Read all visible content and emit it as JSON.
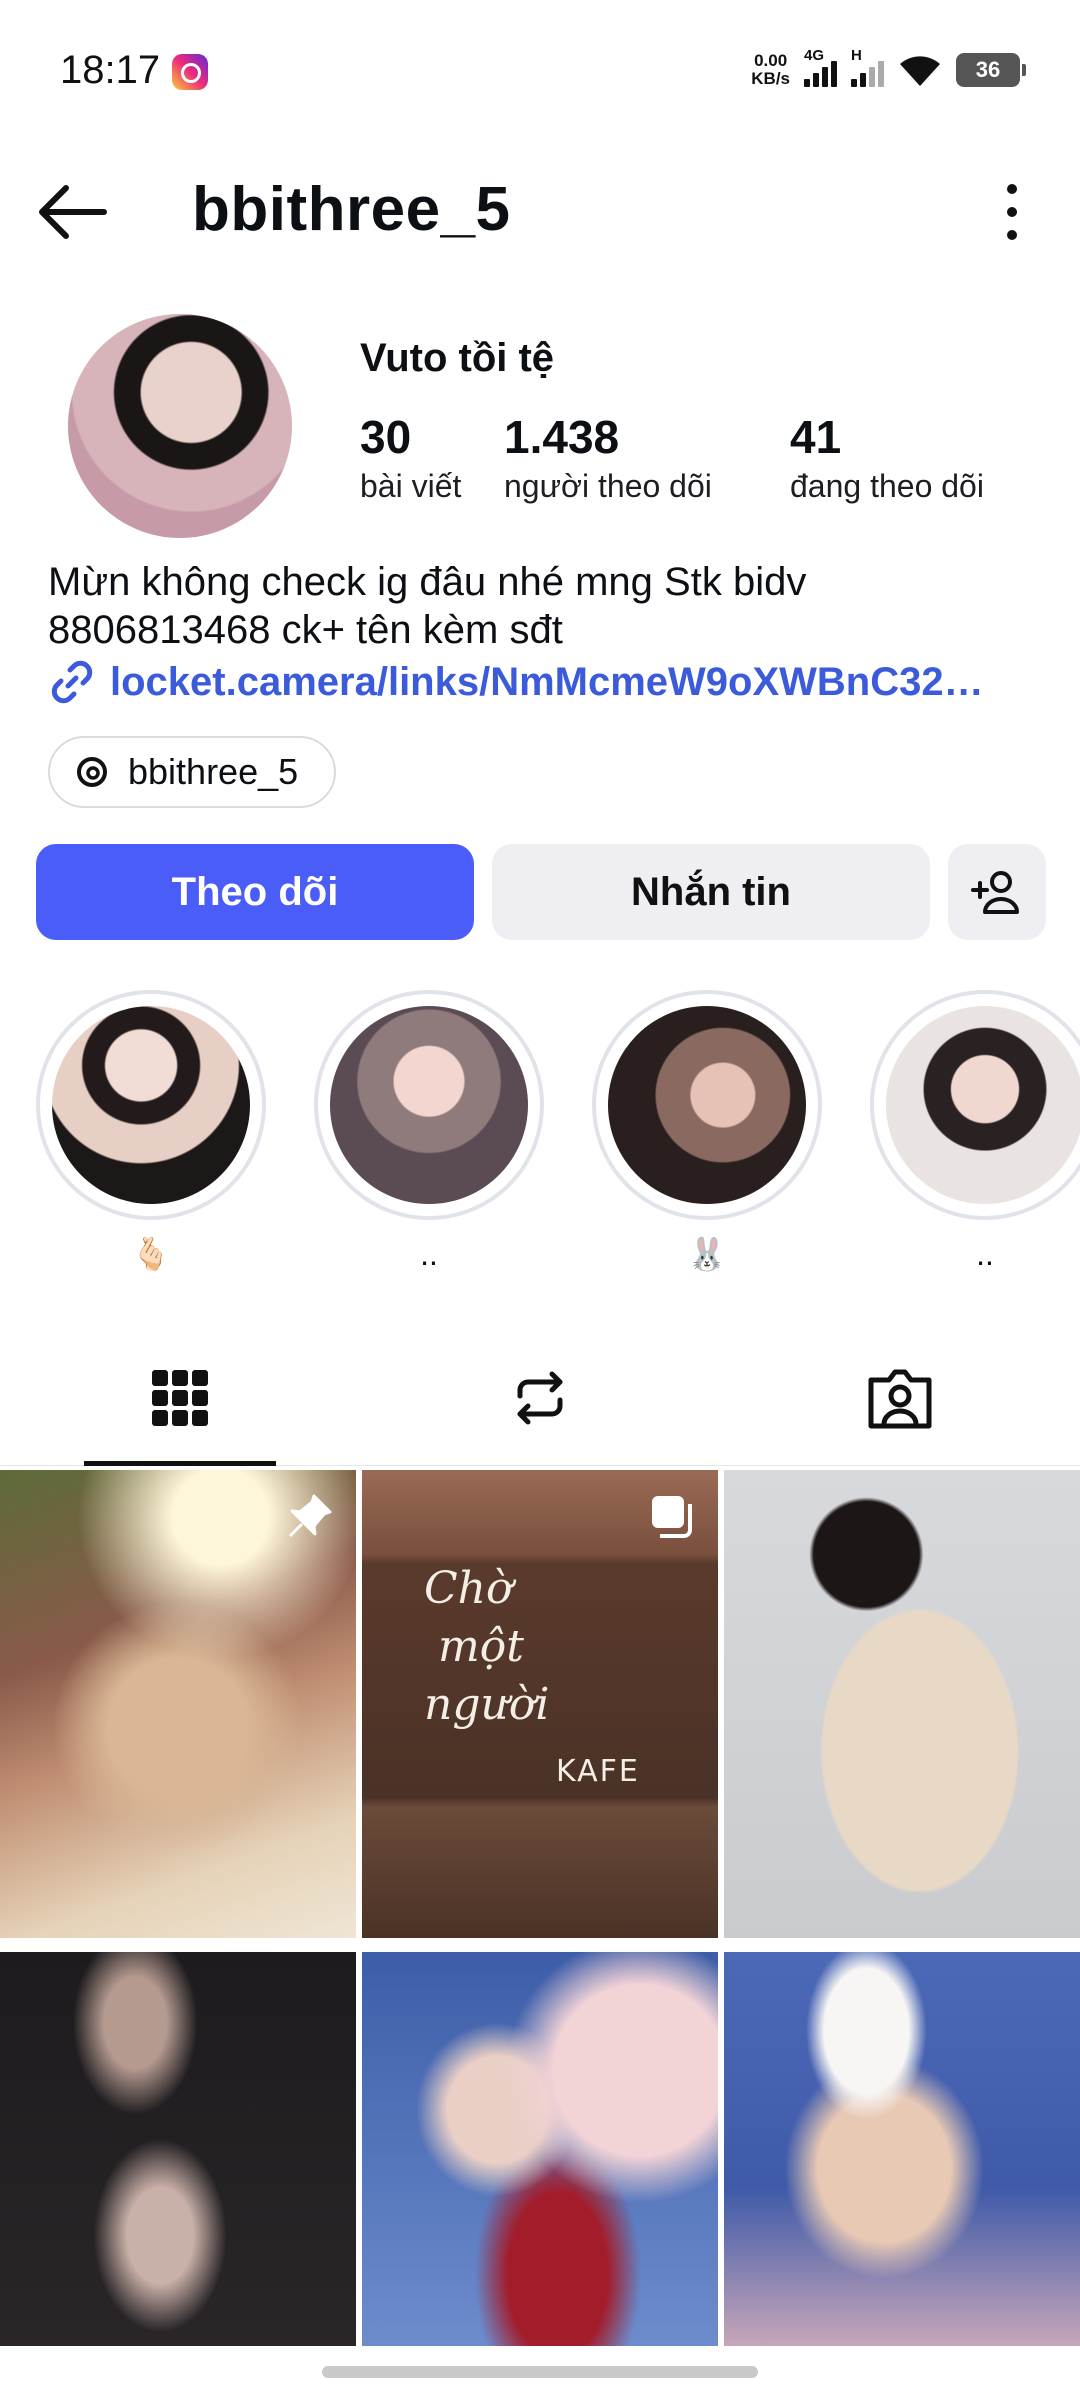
{
  "status_bar": {
    "time": "18:17",
    "net_speed_value": "0.00",
    "net_speed_unit": "KB/s",
    "signal1_label": "4G",
    "signal2_label": "H",
    "battery": "36"
  },
  "header": {
    "username": "bbithree_5"
  },
  "profile": {
    "display_name": "Vuto tồi tệ",
    "stats": [
      {
        "value": "30",
        "label": "bài viết"
      },
      {
        "value": "1.438",
        "label": "người theo dõi"
      },
      {
        "value": "41",
        "label": "đang theo dõi"
      }
    ],
    "bio_line1": "Mừn không check ig đâu nhé mng Stk bidv",
    "bio_line2": "8806813468 ck+ tên kèm sđt",
    "link": "locket.camera/links/NmMcmeW9oXWBnC32…",
    "threads_handle": "bbithree_5"
  },
  "actions": {
    "follow_label": "Theo dõi",
    "message_label": "Nhắn tin"
  },
  "highlights": [
    {
      "label": "🫰🏻"
    },
    {
      "label": ".."
    },
    {
      "label": "🐰"
    },
    {
      "label": ".."
    }
  ],
  "colors": {
    "accent": "#4a5df9",
    "link": "#3b5bdb"
  }
}
